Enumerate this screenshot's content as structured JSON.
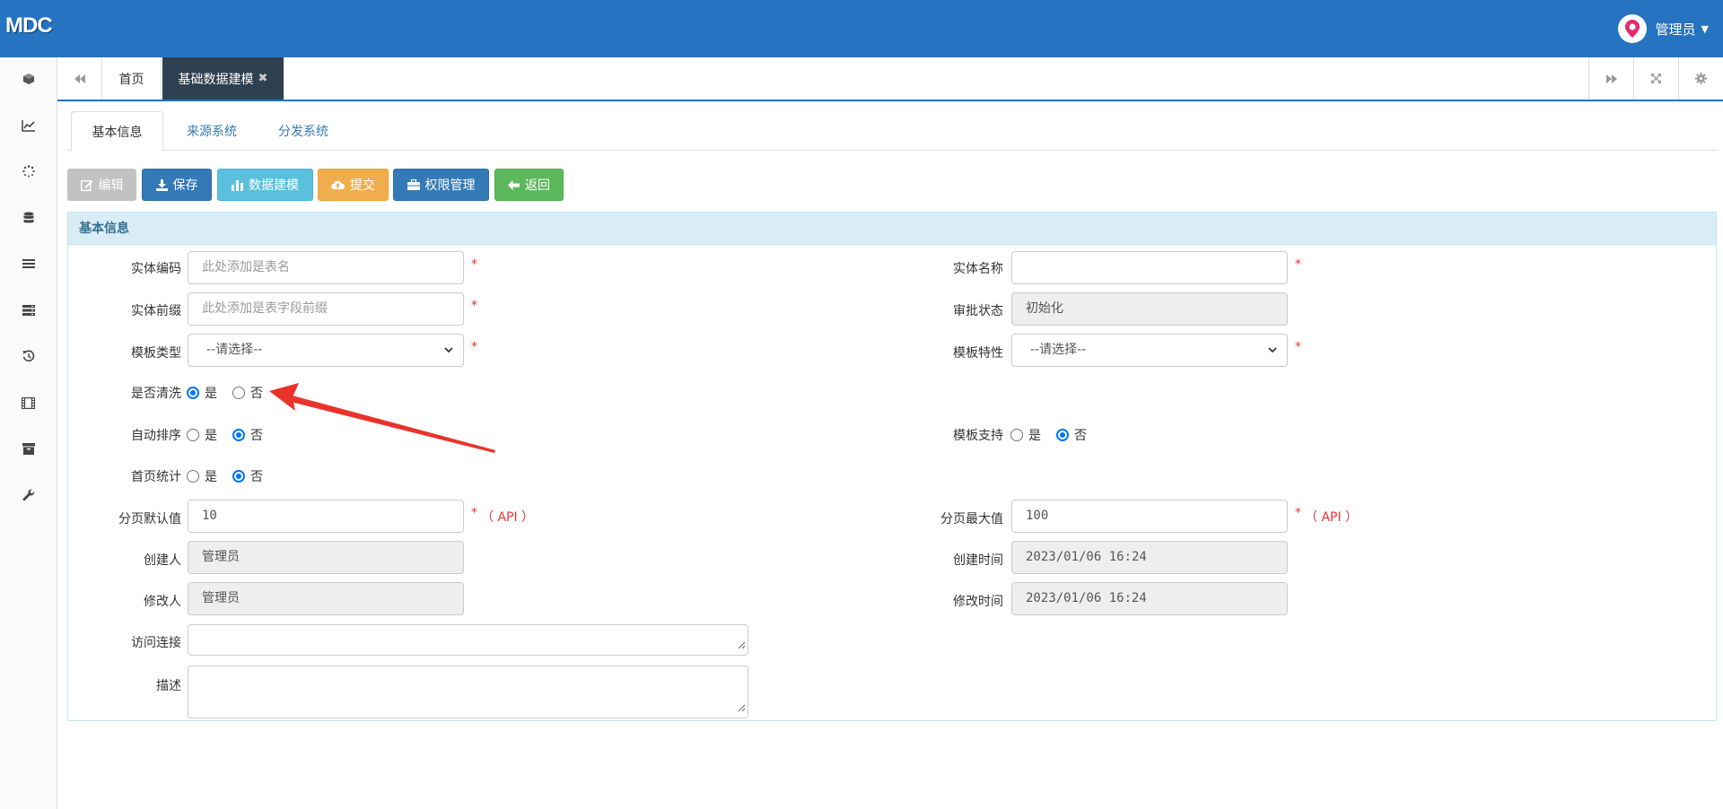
{
  "app": {
    "brand": "MDC",
    "user": "管理员"
  },
  "sidebar": {
    "items": [
      {
        "icon": "cube-icon"
      },
      {
        "icon": "line-chart-icon"
      },
      {
        "icon": "spinner-icon"
      },
      {
        "icon": "database-icon"
      },
      {
        "icon": "list-icon"
      },
      {
        "icon": "server-icon"
      },
      {
        "icon": "history-icon"
      },
      {
        "icon": "film-icon"
      },
      {
        "icon": "archive-icon"
      },
      {
        "icon": "wrench-icon"
      }
    ]
  },
  "tabstrip": {
    "home": "首页",
    "active": "基础数据建模",
    "close": "✖"
  },
  "page_tabs": [
    "基本信息",
    "来源系统",
    "分发系统"
  ],
  "toolbar": {
    "edit": "编辑",
    "save": "保存",
    "model": "数据建模",
    "submit": "提交",
    "permission": "权限管理",
    "back": "返回"
  },
  "panel": {
    "title": "基本信息"
  },
  "form": {
    "entity_code": {
      "label": "实体编码",
      "placeholder": "此处添加是表名",
      "value": ""
    },
    "entity_name": {
      "label": "实体名称",
      "value": ""
    },
    "entity_prefix": {
      "label": "实体前缀",
      "placeholder": "此处添加是表字段前缀",
      "value": ""
    },
    "approval_status": {
      "label": "审批状态",
      "value": "初始化"
    },
    "template_type": {
      "label": "模板类型",
      "value": "--请选择--"
    },
    "template_feature": {
      "label": "模板特性",
      "value": "--请选择--"
    },
    "cleanse": {
      "label": "是否清洗",
      "yes": "是",
      "no": "否",
      "selected": "是"
    },
    "auto_sort": {
      "label": "自动排序",
      "yes": "是",
      "no": "否",
      "selected": "否"
    },
    "template_support": {
      "label": "模板支持",
      "yes": "是",
      "no": "否",
      "selected": "否"
    },
    "home_stats": {
      "label": "首页统计",
      "yes": "是",
      "no": "否",
      "selected": "否"
    },
    "page_default": {
      "label": "分页默认值",
      "value": "10"
    },
    "page_max": {
      "label": "分页最大值",
      "value": "100"
    },
    "creator": {
      "label": "创建人",
      "value": "管理员"
    },
    "created_time": {
      "label": "创建时间",
      "value": "2023/01/06 16:24"
    },
    "modifier": {
      "label": "修改人",
      "value": "管理员"
    },
    "modified_time": {
      "label": "修改时间",
      "value": "2023/01/06 16:24"
    },
    "access_link": {
      "label": "访问连接",
      "value": ""
    },
    "description": {
      "label": "描述",
      "value": ""
    },
    "required_mark": "*",
    "api_note": "（ API ）"
  },
  "colors": {
    "topbar": "#2673c1",
    "annotation_arrow": "#e8332b"
  }
}
